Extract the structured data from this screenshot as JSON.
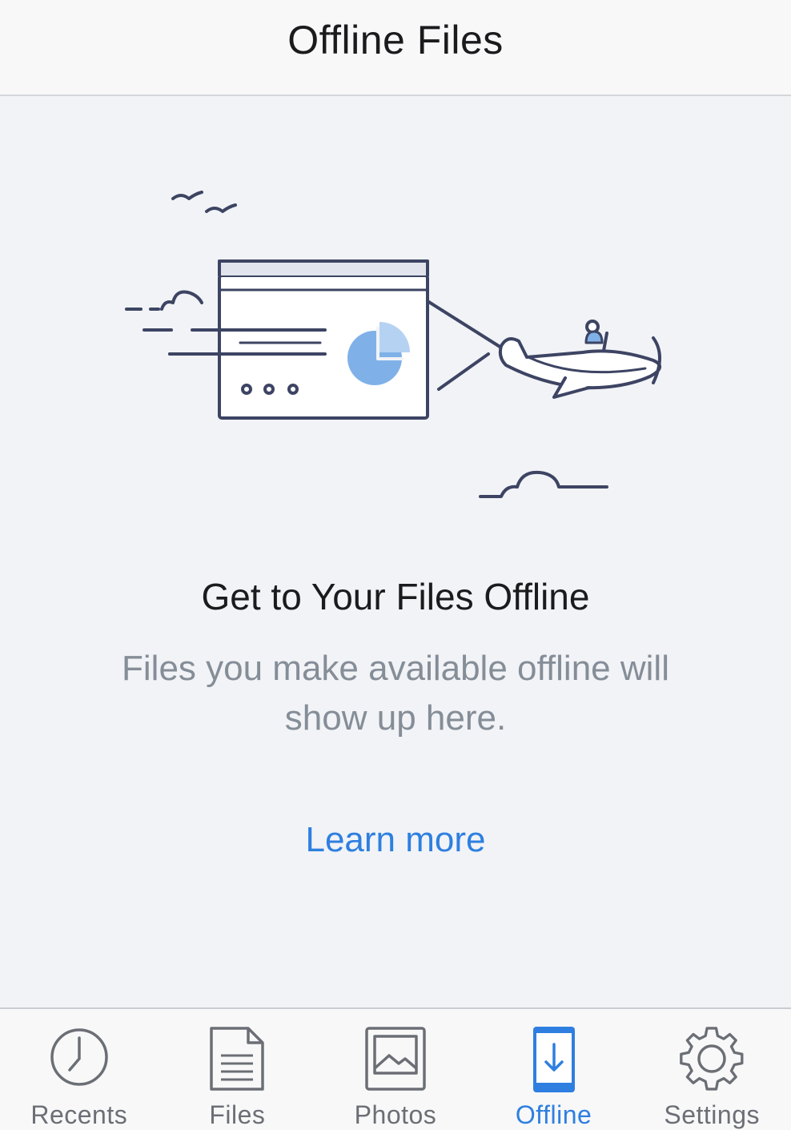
{
  "navbar": {
    "title": "Offline Files"
  },
  "empty_state": {
    "title": "Get to Your Files Offline",
    "description": "Files you make available offline will show up here.",
    "learn_more_label": "Learn more"
  },
  "tabbar": {
    "tabs": [
      {
        "label": "Recents",
        "icon": "clock-icon",
        "active": false
      },
      {
        "label": "Files",
        "icon": "document-icon",
        "active": false
      },
      {
        "label": "Photos",
        "icon": "photo-icon",
        "active": false
      },
      {
        "label": "Offline",
        "icon": "phone-download-icon",
        "active": true
      },
      {
        "label": "Settings",
        "icon": "gear-icon",
        "active": false
      }
    ]
  },
  "colors": {
    "accent": "#2e7fe0",
    "inactive": "#6b6f75",
    "background": "#f1f3f6",
    "illustration_stroke": "#3d4463",
    "illustration_fill": "#7fb1e8"
  }
}
